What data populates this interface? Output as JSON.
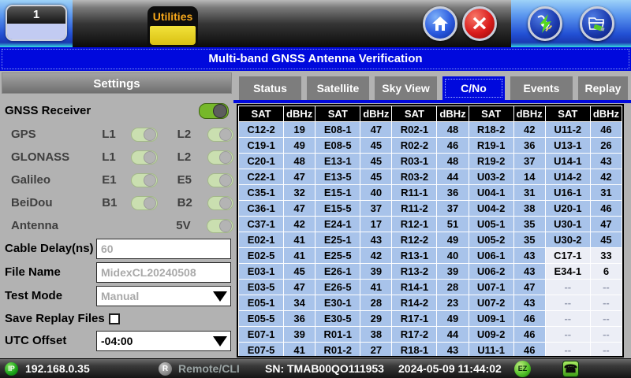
{
  "topbar": {
    "screen_button_label": "1",
    "utilities_tab_label": "Utilities"
  },
  "titlebar": {
    "title": "Multi-band GNSS Antenna Verification"
  },
  "settings": {
    "header": "Settings",
    "gnss_receiver": {
      "label": "GNSS Receiver",
      "on": true
    },
    "constellations": [
      {
        "name": "GPS",
        "bands": [
          {
            "label": "L1",
            "on": true
          },
          {
            "label": "L2",
            "on": true
          }
        ]
      },
      {
        "name": "GLONASS",
        "bands": [
          {
            "label": "L1",
            "on": true
          },
          {
            "label": "L2",
            "on": true
          }
        ]
      },
      {
        "name": "Galileo",
        "bands": [
          {
            "label": "E1",
            "on": true
          },
          {
            "label": "E5",
            "on": true
          }
        ]
      },
      {
        "name": "BeiDou",
        "bands": [
          {
            "label": "B1",
            "on": true
          },
          {
            "label": "B2",
            "on": true
          }
        ]
      }
    ],
    "antenna": {
      "label": "Antenna",
      "band_label": "5V",
      "on": true
    },
    "cable_delay": {
      "label": "Cable Delay(ns)",
      "value": "60",
      "enabled": false
    },
    "file_name": {
      "label": "File Name",
      "value": "MidexCL20240508",
      "enabled": false
    },
    "test_mode": {
      "label": "Test Mode",
      "value": "Manual",
      "enabled": false
    },
    "save_replay": {
      "label": "Save Replay Files",
      "checked": false
    },
    "utc_offset": {
      "label": "UTC Offset",
      "value": "-04:00",
      "enabled": true
    }
  },
  "tabs": {
    "items": [
      "Status",
      "Satellite",
      "Sky View",
      "C/No",
      "Events",
      "Replay"
    ],
    "selected": "C/No"
  },
  "cno_table": {
    "col_headers": [
      "SAT",
      "dBHz"
    ],
    "rows": [
      [
        {
          "sat": "C12-2",
          "dbhz": "19",
          "state": "normal"
        },
        {
          "sat": "E08-1",
          "dbhz": "47",
          "state": "normal"
        },
        {
          "sat": "R02-1",
          "dbhz": "48",
          "state": "normal"
        },
        {
          "sat": "R18-2",
          "dbhz": "42",
          "state": "normal"
        },
        {
          "sat": "U11-2",
          "dbhz": "46",
          "state": "normal"
        }
      ],
      [
        {
          "sat": "C19-1",
          "dbhz": "49",
          "state": "normal"
        },
        {
          "sat": "E08-5",
          "dbhz": "45",
          "state": "normal"
        },
        {
          "sat": "R02-2",
          "dbhz": "46",
          "state": "normal"
        },
        {
          "sat": "R19-1",
          "dbhz": "36",
          "state": "normal"
        },
        {
          "sat": "U13-1",
          "dbhz": "26",
          "state": "normal"
        }
      ],
      [
        {
          "sat": "C20-1",
          "dbhz": "48",
          "state": "normal"
        },
        {
          "sat": "E13-1",
          "dbhz": "45",
          "state": "normal"
        },
        {
          "sat": "R03-1",
          "dbhz": "48",
          "state": "normal"
        },
        {
          "sat": "R19-2",
          "dbhz": "37",
          "state": "normal"
        },
        {
          "sat": "U14-1",
          "dbhz": "43",
          "state": "normal"
        }
      ],
      [
        {
          "sat": "C22-1",
          "dbhz": "47",
          "state": "normal"
        },
        {
          "sat": "E13-5",
          "dbhz": "45",
          "state": "normal"
        },
        {
          "sat": "R03-2",
          "dbhz": "44",
          "state": "normal"
        },
        {
          "sat": "U03-2",
          "dbhz": "14",
          "state": "normal"
        },
        {
          "sat": "U14-2",
          "dbhz": "42",
          "state": "normal"
        }
      ],
      [
        {
          "sat": "C35-1",
          "dbhz": "32",
          "state": "normal"
        },
        {
          "sat": "E15-1",
          "dbhz": "40",
          "state": "normal"
        },
        {
          "sat": "R11-1",
          "dbhz": "36",
          "state": "normal"
        },
        {
          "sat": "U04-1",
          "dbhz": "31",
          "state": "normal"
        },
        {
          "sat": "U16-1",
          "dbhz": "31",
          "state": "normal"
        }
      ],
      [
        {
          "sat": "C36-1",
          "dbhz": "47",
          "state": "normal"
        },
        {
          "sat": "E15-5",
          "dbhz": "37",
          "state": "normal"
        },
        {
          "sat": "R11-2",
          "dbhz": "37",
          "state": "normal"
        },
        {
          "sat": "U04-2",
          "dbhz": "38",
          "state": "normal"
        },
        {
          "sat": "U20-1",
          "dbhz": "46",
          "state": "normal"
        }
      ],
      [
        {
          "sat": "C37-1",
          "dbhz": "42",
          "state": "normal"
        },
        {
          "sat": "E24-1",
          "dbhz": "17",
          "state": "normal"
        },
        {
          "sat": "R12-1",
          "dbhz": "51",
          "state": "normal"
        },
        {
          "sat": "U05-1",
          "dbhz": "35",
          "state": "normal"
        },
        {
          "sat": "U30-1",
          "dbhz": "47",
          "state": "normal"
        }
      ],
      [
        {
          "sat": "E02-1",
          "dbhz": "41",
          "state": "normal"
        },
        {
          "sat": "E25-1",
          "dbhz": "43",
          "state": "normal"
        },
        {
          "sat": "R12-2",
          "dbhz": "49",
          "state": "normal"
        },
        {
          "sat": "U05-2",
          "dbhz": "35",
          "state": "normal"
        },
        {
          "sat": "U30-2",
          "dbhz": "45",
          "state": "normal"
        }
      ],
      [
        {
          "sat": "E02-5",
          "dbhz": "41",
          "state": "normal"
        },
        {
          "sat": "E25-5",
          "dbhz": "42",
          "state": "normal"
        },
        {
          "sat": "R13-1",
          "dbhz": "40",
          "state": "normal"
        },
        {
          "sat": "U06-1",
          "dbhz": "43",
          "state": "normal"
        },
        {
          "sat": "C17-1",
          "dbhz": "33",
          "state": "weak"
        }
      ],
      [
        {
          "sat": "E03-1",
          "dbhz": "45",
          "state": "normal"
        },
        {
          "sat": "E26-1",
          "dbhz": "39",
          "state": "normal"
        },
        {
          "sat": "R13-2",
          "dbhz": "39",
          "state": "normal"
        },
        {
          "sat": "U06-2",
          "dbhz": "43",
          "state": "normal"
        },
        {
          "sat": "E34-1",
          "dbhz": "6",
          "state": "weak"
        }
      ],
      [
        {
          "sat": "E03-5",
          "dbhz": "47",
          "state": "normal"
        },
        {
          "sat": "E26-5",
          "dbhz": "41",
          "state": "normal"
        },
        {
          "sat": "R14-1",
          "dbhz": "28",
          "state": "normal"
        },
        {
          "sat": "U07-1",
          "dbhz": "47",
          "state": "normal"
        },
        {
          "sat": "--",
          "dbhz": "--",
          "state": "empty"
        }
      ],
      [
        {
          "sat": "E05-1",
          "dbhz": "34",
          "state": "normal"
        },
        {
          "sat": "E30-1",
          "dbhz": "28",
          "state": "normal"
        },
        {
          "sat": "R14-2",
          "dbhz": "23",
          "state": "normal"
        },
        {
          "sat": "U07-2",
          "dbhz": "43",
          "state": "normal"
        },
        {
          "sat": "--",
          "dbhz": "--",
          "state": "empty"
        }
      ],
      [
        {
          "sat": "E05-5",
          "dbhz": "36",
          "state": "normal"
        },
        {
          "sat": "E30-5",
          "dbhz": "29",
          "state": "normal"
        },
        {
          "sat": "R17-1",
          "dbhz": "49",
          "state": "normal"
        },
        {
          "sat": "U09-1",
          "dbhz": "46",
          "state": "normal"
        },
        {
          "sat": "--",
          "dbhz": "--",
          "state": "empty"
        }
      ],
      [
        {
          "sat": "E07-1",
          "dbhz": "39",
          "state": "normal"
        },
        {
          "sat": "R01-1",
          "dbhz": "38",
          "state": "normal"
        },
        {
          "sat": "R17-2",
          "dbhz": "44",
          "state": "normal"
        },
        {
          "sat": "U09-2",
          "dbhz": "46",
          "state": "normal"
        },
        {
          "sat": "--",
          "dbhz": "--",
          "state": "empty"
        }
      ],
      [
        {
          "sat": "E07-5",
          "dbhz": "41",
          "state": "normal"
        },
        {
          "sat": "R01-2",
          "dbhz": "27",
          "state": "normal"
        },
        {
          "sat": "R18-1",
          "dbhz": "43",
          "state": "normal"
        },
        {
          "sat": "U11-1",
          "dbhz": "46",
          "state": "normal"
        },
        {
          "sat": "--",
          "dbhz": "--",
          "state": "empty"
        }
      ]
    ]
  },
  "statusbar": {
    "ip_badge": "IP",
    "ip_address": "192.168.0.35",
    "remote_badge": "R",
    "remote_label": "Remote/CLI",
    "serial": "SN: TMAB00QO111953",
    "datetime": "2024-05-09 11:44:02",
    "ez_badge": "EZ",
    "phone_glyph": "☎"
  },
  "colors": {
    "accent_blue": "#0009dd",
    "table_row_blue": "#a8c3ea",
    "table_weak_bg": "#eceef6",
    "toggle_green": "#76b82a",
    "tab_gray": "#7d7d7d",
    "utilities_yellow": "#e8d020",
    "panel_gray": "#b2b2b2"
  }
}
